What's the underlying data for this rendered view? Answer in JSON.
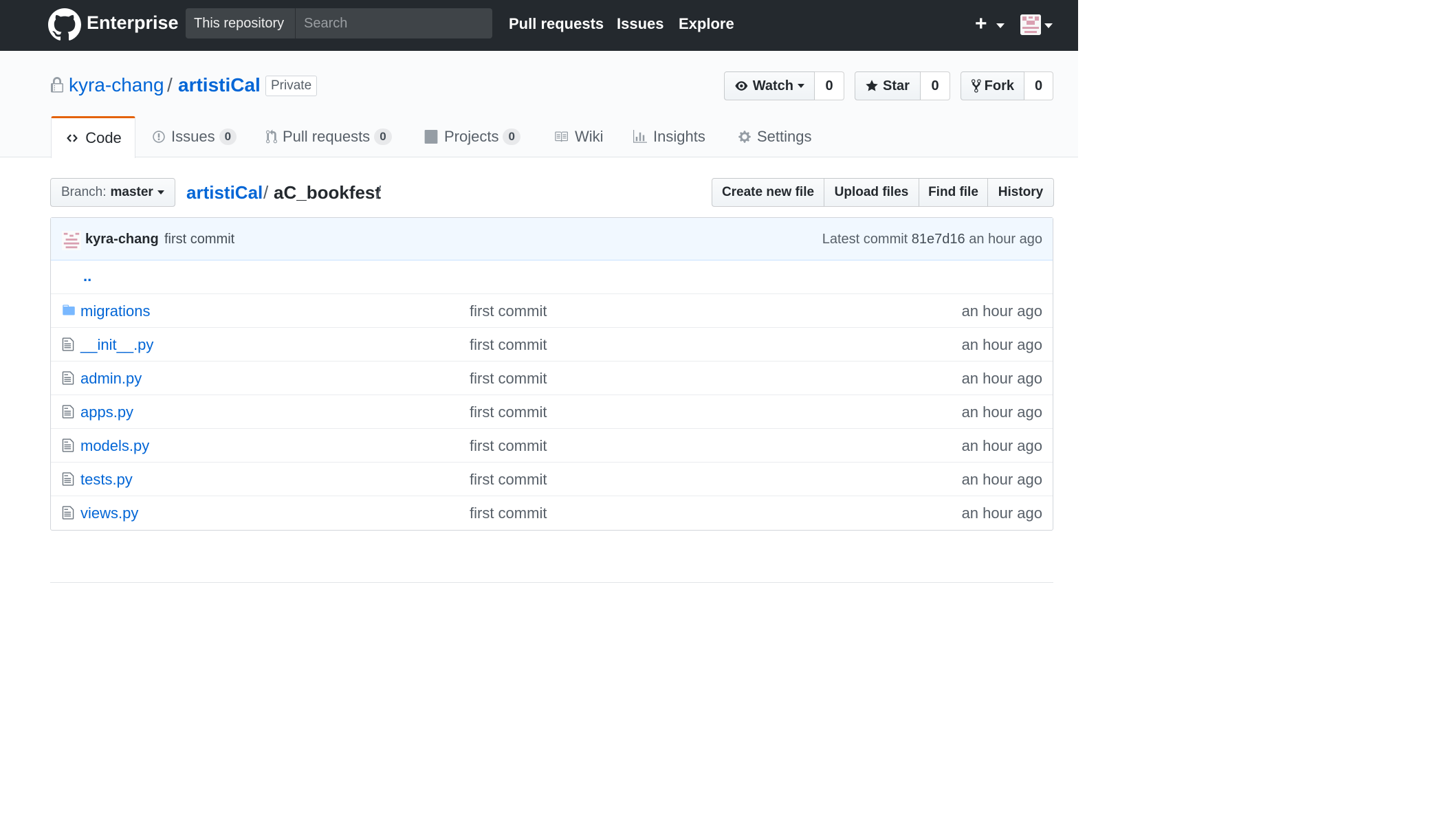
{
  "header": {
    "brand": "Enterprise",
    "scope_label": "This repository",
    "search_placeholder": "Search",
    "nav": [
      "Pull requests",
      "Issues",
      "Explore"
    ]
  },
  "repo": {
    "owner": "kyra-chang",
    "separator": "/",
    "name": "artistiCal",
    "visibility": "Private",
    "watch": {
      "label": "Watch",
      "count": "0"
    },
    "star": {
      "label": "Star",
      "count": "0"
    },
    "fork": {
      "label": "Fork",
      "count": "0"
    }
  },
  "tabs": [
    {
      "label": "Code",
      "icon": "code-icon"
    },
    {
      "label": "Issues",
      "count": "0",
      "icon": "issue-icon"
    },
    {
      "label": "Pull requests",
      "count": "0",
      "icon": "pull-request-icon"
    },
    {
      "label": "Projects",
      "count": "0",
      "icon": "project-icon"
    },
    {
      "label": "Wiki",
      "icon": "book-icon"
    },
    {
      "label": "Insights",
      "icon": "graph-icon"
    },
    {
      "label": "Settings",
      "icon": "gear-icon"
    }
  ],
  "filenav": {
    "branch_prefix": "Branch:",
    "branch": "master",
    "crumb_root": "artistiCal",
    "crumb_sep": "/",
    "crumb_current": "aC_bookfest",
    "crumb_trail": "/",
    "actions": [
      "Create new file",
      "Upload files",
      "Find file",
      "History"
    ]
  },
  "commit": {
    "author": "kyra-chang",
    "message": "first commit",
    "latest_label": "Latest commit",
    "sha": "81e7d16",
    "age": "an hour ago"
  },
  "parent_link": "..",
  "files": [
    {
      "name": "migrations",
      "type": "directory",
      "message": "first commit",
      "age": "an hour ago"
    },
    {
      "name": "__init__.py",
      "type": "file",
      "message": "first commit",
      "age": "an hour ago"
    },
    {
      "name": "admin.py",
      "type": "file",
      "message": "first commit",
      "age": "an hour ago"
    },
    {
      "name": "apps.py",
      "type": "file",
      "message": "first commit",
      "age": "an hour ago"
    },
    {
      "name": "models.py",
      "type": "file",
      "message": "first commit",
      "age": "an hour ago"
    },
    {
      "name": "tests.py",
      "type": "file",
      "message": "first commit",
      "age": "an hour ago"
    },
    {
      "name": "views.py",
      "type": "file",
      "message": "first commit",
      "age": "an hour ago"
    }
  ],
  "colors": {
    "header_bg": "#24292e",
    "link": "#0366d6",
    "tab_accent": "#e36209",
    "commit_bar_bg": "#f1f8ff"
  }
}
